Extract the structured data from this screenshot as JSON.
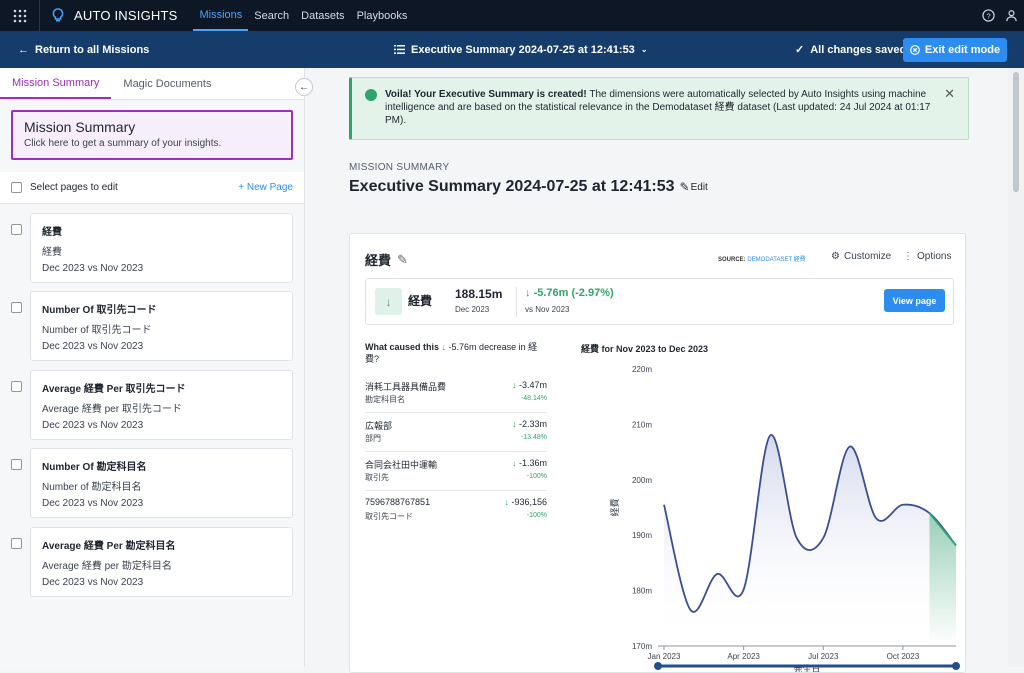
{
  "topnav": {
    "brand": "AUTO INSIGHTS",
    "links": [
      "Missions",
      "Search",
      "Datasets",
      "Playbooks"
    ],
    "active": "Missions"
  },
  "subbar": {
    "back": "Return to all Missions",
    "title": "Executive Summary 2024-07-25 at 12:41:53",
    "saved": "All changes saved",
    "exit": "Exit edit mode"
  },
  "left": {
    "tabs": [
      "Mission Summary",
      "Magic Documents"
    ],
    "summary_box": {
      "title": "Mission Summary",
      "subtitle": "Click here to get a summary of your insights."
    },
    "select_label": "Select pages to edit",
    "new_page": "+ New Page",
    "pages": [
      {
        "title": "経費",
        "line1": "経費",
        "line2": "Dec 2023 vs Nov 2023"
      },
      {
        "title": "Number Of 取引先コード",
        "line1": "Number of 取引先コード",
        "line2": "Dec 2023 vs Nov 2023"
      },
      {
        "title": "Average 経費 Per 取引先コード",
        "line1": "Average 経費 per 取引先コード",
        "line2": "Dec 2023 vs Nov 2023"
      },
      {
        "title": "Number Of 勘定科目名",
        "line1": "Number of 勘定科目名",
        "line2": "Dec 2023 vs Nov 2023"
      },
      {
        "title": "Average 経費 Per 勘定科目名",
        "line1": "Average 経費 per 勘定科目名",
        "line2": "Dec 2023 vs Nov 2023"
      }
    ]
  },
  "alert": {
    "bold": "Voila! Your Executive Summary is created!",
    "text": " The dimensions were automatically selected by Auto Insights using machine intelligence and are based on the statistical relevance in the Demodataset 経費 dataset (Last updated: 24 Jul 2024 at 01:17 PM)."
  },
  "main": {
    "kicker": "MISSION SUMMARY",
    "title": "Executive Summary 2024-07-25 at 12:41:53",
    "edit": "Edit"
  },
  "card": {
    "title": "経費",
    "source_label": "SOURCE:",
    "source_value": "DEMODATASET 経費",
    "customize": "Customize",
    "options": "Options",
    "kpi": {
      "name": "経費",
      "value": "188.15m",
      "value_period": "Dec 2023",
      "change": "-5.76m (-2.97%)",
      "change_period": "vs Nov 2023",
      "button": "View page"
    },
    "caused_prefix": "What caused this",
    "caused_value": "-5.76m decrease in 経費?",
    "drivers": [
      {
        "name": "消耗工具器具備品費",
        "cat": "勘定科目名",
        "value": "-3.47m",
        "pct": "-48.14%"
      },
      {
        "name": "広報部",
        "cat": "部門",
        "value": "-2.33m",
        "pct": "-13.48%"
      },
      {
        "name": "合同会社田中運輸",
        "cat": "取引先",
        "value": "-1.36m",
        "pct": "-100%"
      },
      {
        "name": "7596788767851",
        "cat": "取引先コード",
        "value": "-936,156",
        "pct": "-100%"
      }
    ]
  },
  "chart_data": {
    "type": "line",
    "title": "経費 for Nov 2023 to Dec 2023",
    "xlabel": "発生日",
    "ylabel": "経費",
    "x_ticks": [
      "Jan 2023",
      "Apr 2023",
      "Jul 2023",
      "Oct 2023"
    ],
    "y_ticks": [
      "170m",
      "180m",
      "190m",
      "200m",
      "210m",
      "220m"
    ],
    "ylim": [
      170,
      220
    ],
    "x": [
      "Jan 2023",
      "Feb 2023",
      "Mar 2023",
      "Apr 2023",
      "May 2023",
      "Jun 2023",
      "Jul 2023",
      "Aug 2023",
      "Sep 2023",
      "Oct 2023",
      "Nov 2023",
      "Dec 2023"
    ],
    "values": [
      195.5,
      176.5,
      183.0,
      180.2,
      208.0,
      189.5,
      189.5,
      206.0,
      193.0,
      195.5,
      194.0,
      188.15
    ],
    "highlight_range": [
      "Nov 2023",
      "Dec 2023"
    ],
    "colors": {
      "line": "#3b4f8f",
      "highlight": "#2fa56b"
    }
  }
}
